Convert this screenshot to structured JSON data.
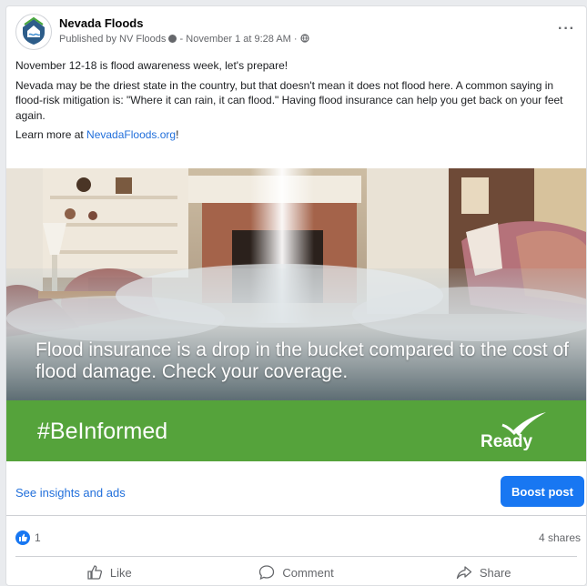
{
  "post": {
    "page_name": "Nevada Floods",
    "published_by": "Published by NV Floods",
    "date": "November 1 at 9:28 AM",
    "separator": "·",
    "more_label": "···",
    "text_line1": "November 12-18 is flood awareness week, let's prepare!",
    "text_line2": "Nevada may be the driest state in the country, but that doesn't mean it does not flood here. A common saying in flood-risk mitigation is: \"Where it can rain, it can flood.\" Having flood insurance can help you get back on your feet again.",
    "learn_more_prefix": "Learn more at ",
    "learn_more_link": "NevadaFloods.org",
    "learn_more_suffix": "!"
  },
  "image": {
    "overlay_text": "Flood insurance is a drop in the bucket compared to the cost of flood damage. Check your coverage.",
    "hashtag": "#BeInformed",
    "logo_text": "Ready",
    "banner_color": "#55a33b"
  },
  "insights": {
    "link_label": "See insights and ads",
    "boost_label": "Boost post"
  },
  "stats": {
    "reactions_count": "1",
    "shares": "4 shares"
  },
  "actions": {
    "like": "Like",
    "comment": "Comment",
    "share": "Share"
  },
  "icons": {
    "avatar": "nevada-floods-shield-icon",
    "privacy": "globe-icon",
    "verified": "info-icon",
    "like": "thumbs-up-icon",
    "comment": "speech-bubble-icon",
    "share": "share-arrow-icon"
  },
  "colors": {
    "accent": "#1877f2",
    "link": "#216fdb",
    "muted": "#65676b"
  }
}
